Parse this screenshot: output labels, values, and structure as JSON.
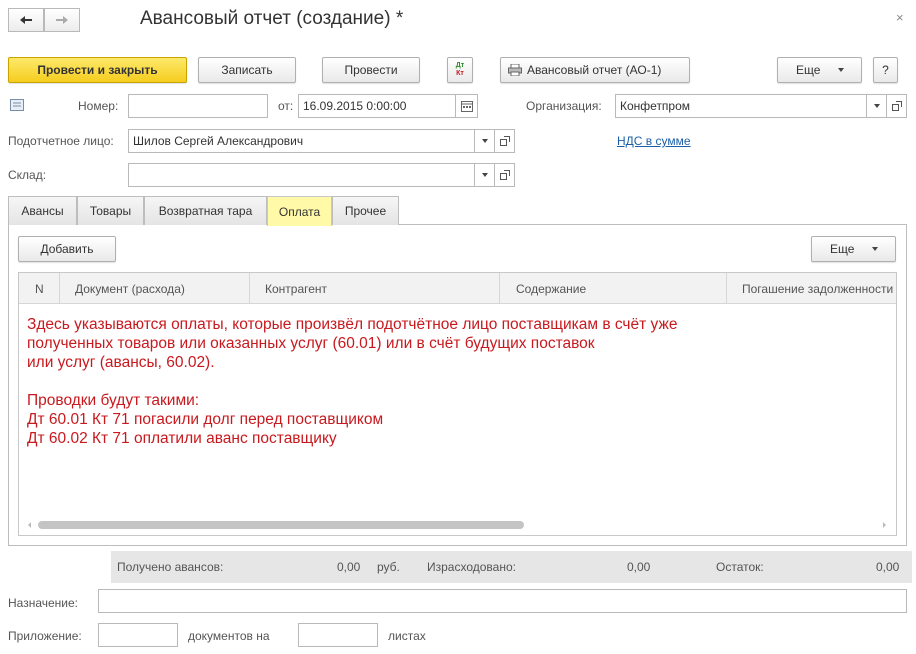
{
  "window": {
    "title": "Авансовый отчет (создание) *",
    "close_symbol": "×"
  },
  "toolbar": {
    "post_close_label": "Провести и закрыть",
    "save_label": "Записать",
    "post_label": "Провести",
    "report_label": "Авансовый отчет (АО-1)",
    "more_label": "Еще",
    "help_label": "?",
    "dtkt_top": "Дт",
    "dtkt_bottom": "Кт"
  },
  "header_fields": {
    "number_label": "Номер:",
    "number_value": "",
    "date_label": "от:",
    "date_value": "16.09.2015  0:00:00",
    "org_label": "Организация:",
    "org_value": "Конфетпром",
    "person_label": "Подотчетное лицо:",
    "person_value": "Шилов Сергей Александрович",
    "vat_link": "НДС в сумме",
    "warehouse_label": "Склад:",
    "warehouse_value": ""
  },
  "tabs": [
    {
      "label": "Авансы"
    },
    {
      "label": "Товары"
    },
    {
      "label": "Возвратная тара"
    },
    {
      "label": "Оплата"
    },
    {
      "label": "Прочее"
    }
  ],
  "panel": {
    "add_label": "Добавить",
    "more_label": "Еще"
  },
  "table": {
    "columns": [
      "N",
      "Документ (расхода)",
      "Контрагент",
      "Содержание",
      "Погашение задолженности"
    ]
  },
  "annotation": {
    "lines": [
      "Здесь указываются оплаты, которые произвёл подотчётное лицо поставщикам в счёт уже",
      "полученных товаров или оказанных услуг (60.01) или в счёт будущих поставок",
      "или услуг (авансы, 60.02).",
      "",
      "Проводки будут такими:",
      "Дт 60.01 Кт 71 погасили долг перед поставщиком",
      "Дт 60.02 Кт 71 оплатили аванс поставщику"
    ]
  },
  "totals": {
    "advances_label": "Получено авансов:",
    "advances_value": "0,00",
    "currency": "руб.",
    "spent_label": "Израсходовано:",
    "spent_value": "0,00",
    "balance_label": "Остаток:",
    "balance_value": "0,00"
  },
  "footer": {
    "purpose_label": "Назначение:",
    "purpose_value": "",
    "attachment_label": "Приложение:",
    "docs_label": "документов на",
    "sheets_label": "листах",
    "docs_value": "",
    "sheets_value": ""
  },
  "colors": {
    "primary_button": "#f5cd1f",
    "active_tab": "#fff9a8",
    "annotation_text": "#c8191e",
    "link": "#1c5fa8"
  }
}
